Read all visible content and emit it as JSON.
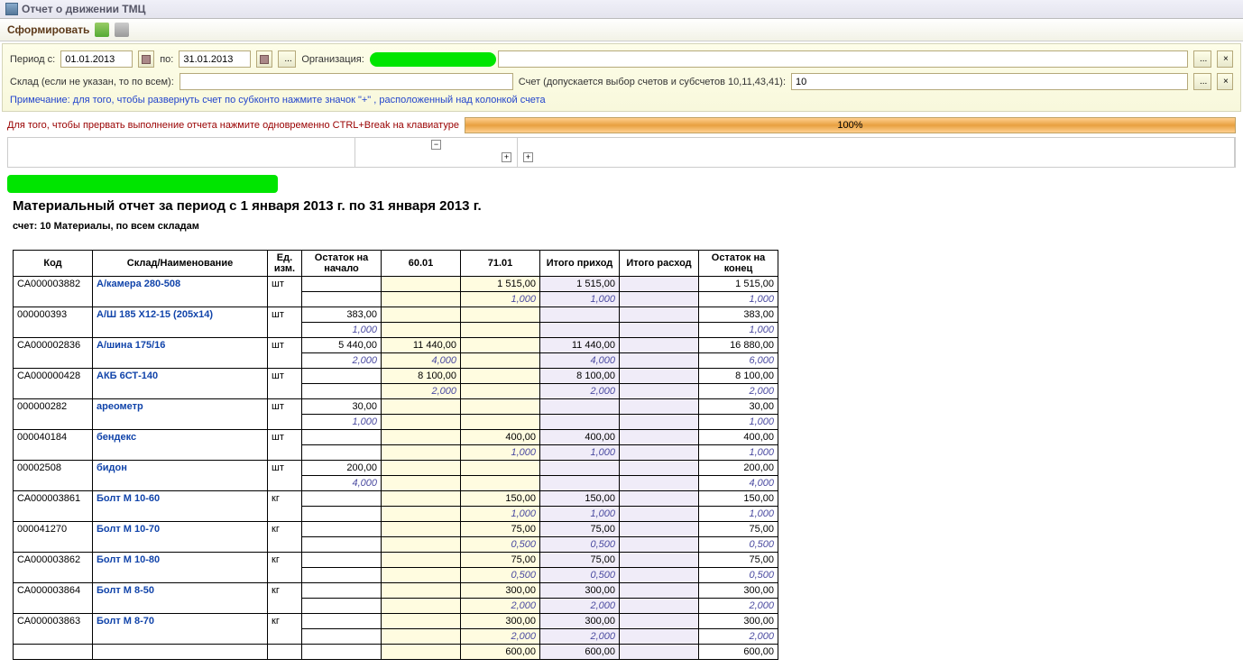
{
  "window": {
    "title": "Отчет о движении ТМЦ"
  },
  "toolbar": {
    "form_btn": "Сформировать"
  },
  "params": {
    "period_from_label": "Период с:",
    "period_from": "01.01.2013",
    "period_to_label": "по:",
    "period_to": "31.01.2013",
    "org_label": "Организация:",
    "warehouse_label": "Склад (если не указан, то по всем):",
    "account_label": "Счет (допускается выбор счетов и субсчетов 10,11,43,41):",
    "account_value": "10",
    "note": "Примечание: для того, чтобы развернуть счет по субконто нажмите значок \"+\" , расположенный над колонкой счета"
  },
  "interrupt": {
    "text": "Для того, чтобы прервать выполнение отчета нажмите одновременно CTRL+Break на клавиатуре",
    "progress": "100%"
  },
  "report": {
    "title": "Материальный отчет за период с 1 января 2013 г. по 31 января 2013 г.",
    "subtitle": "счет: 10 Материалы, по всем складам",
    "headers": {
      "code": "Код",
      "name": "Склад/Наименование",
      "unit": "Ед. изм.",
      "start": "Остаток на начало",
      "c6001": "60.01",
      "c7101": "71.01",
      "in": "Итого приход",
      "out": "Итого расход",
      "end": "Остаток на конец"
    },
    "rows": [
      {
        "code": "СА000003882",
        "name": "А/камера 280-508",
        "unit": "шт",
        "start": "",
        "start_q": "",
        "c6001": "",
        "c6001_q": "",
        "c7101": "1 515,00",
        "c7101_q": "1,000",
        "in": "1 515,00",
        "in_q": "1,000",
        "out": "",
        "out_q": "",
        "end": "1 515,00",
        "end_q": "1,000"
      },
      {
        "code": "000000393",
        "name": "А/Ш 185 Х12-15 (205х14)",
        "unit": "шт",
        "start": "383,00",
        "start_q": "1,000",
        "c6001": "",
        "c6001_q": "",
        "c7101": "",
        "c7101_q": "",
        "in": "",
        "in_q": "",
        "out": "",
        "out_q": "",
        "end": "383,00",
        "end_q": "1,000"
      },
      {
        "code": "СА000002836",
        "name": "А/шина 175/16",
        "unit": "шт",
        "start": "5 440,00",
        "start_q": "2,000",
        "c6001": "11 440,00",
        "c6001_q": "4,000",
        "c7101": "",
        "c7101_q": "",
        "in": "11 440,00",
        "in_q": "4,000",
        "out": "",
        "out_q": "",
        "end": "16 880,00",
        "end_q": "6,000"
      },
      {
        "code": "СА000000428",
        "name": "АКБ 6СТ-140",
        "unit": "шт",
        "start": "",
        "start_q": "",
        "c6001": "8 100,00",
        "c6001_q": "2,000",
        "c7101": "",
        "c7101_q": "",
        "in": "8 100,00",
        "in_q": "2,000",
        "out": "",
        "out_q": "",
        "end": "8 100,00",
        "end_q": "2,000"
      },
      {
        "code": "000000282",
        "name": "ареометр",
        "unit": "шт",
        "start": "30,00",
        "start_q": "1,000",
        "c6001": "",
        "c6001_q": "",
        "c7101": "",
        "c7101_q": "",
        "in": "",
        "in_q": "",
        "out": "",
        "out_q": "",
        "end": "30,00",
        "end_q": "1,000"
      },
      {
        "code": "000040184",
        "name": "бендекс",
        "unit": "шт",
        "start": "",
        "start_q": "",
        "c6001": "",
        "c6001_q": "",
        "c7101": "400,00",
        "c7101_q": "1,000",
        "in": "400,00",
        "in_q": "1,000",
        "out": "",
        "out_q": "",
        "end": "400,00",
        "end_q": "1,000"
      },
      {
        "code": "00002508",
        "name": "бидон",
        "unit": "шт",
        "start": "200,00",
        "start_q": "4,000",
        "c6001": "",
        "c6001_q": "",
        "c7101": "",
        "c7101_q": "",
        "in": "",
        "in_q": "",
        "out": "",
        "out_q": "",
        "end": "200,00",
        "end_q": "4,000"
      },
      {
        "code": "СА000003861",
        "name": "Болт М 10-60",
        "unit": "кг",
        "start": "",
        "start_q": "",
        "c6001": "",
        "c6001_q": "",
        "c7101": "150,00",
        "c7101_q": "1,000",
        "in": "150,00",
        "in_q": "1,000",
        "out": "",
        "out_q": "",
        "end": "150,00",
        "end_q": "1,000"
      },
      {
        "code": "000041270",
        "name": "Болт М 10-70",
        "unit": "кг",
        "start": "",
        "start_q": "",
        "c6001": "",
        "c6001_q": "",
        "c7101": "75,00",
        "c7101_q": "0,500",
        "in": "75,00",
        "in_q": "0,500",
        "out": "",
        "out_q": "",
        "end": "75,00",
        "end_q": "0,500"
      },
      {
        "code": "СА000003862",
        "name": "Болт М 10-80",
        "unit": "кг",
        "start": "",
        "start_q": "",
        "c6001": "",
        "c6001_q": "",
        "c7101": "75,00",
        "c7101_q": "0,500",
        "in": "75,00",
        "in_q": "0,500",
        "out": "",
        "out_q": "",
        "end": "75,00",
        "end_q": "0,500"
      },
      {
        "code": "СА000003864",
        "name": "Болт М 8-50",
        "unit": "кг",
        "start": "",
        "start_q": "",
        "c6001": "",
        "c6001_q": "",
        "c7101": "300,00",
        "c7101_q": "2,000",
        "in": "300,00",
        "in_q": "2,000",
        "out": "",
        "out_q": "",
        "end": "300,00",
        "end_q": "2,000"
      },
      {
        "code": "СА000003863",
        "name": "Болт М 8-70",
        "unit": "кг",
        "start": "",
        "start_q": "",
        "c6001": "",
        "c6001_q": "",
        "c7101": "300,00",
        "c7101_q": "2,000",
        "in": "300,00",
        "in_q": "2,000",
        "out": "",
        "out_q": "",
        "end": "300,00",
        "end_q": "2,000"
      }
    ],
    "tail": {
      "c7101": "600,00",
      "in": "600,00",
      "end": "600,00"
    }
  }
}
